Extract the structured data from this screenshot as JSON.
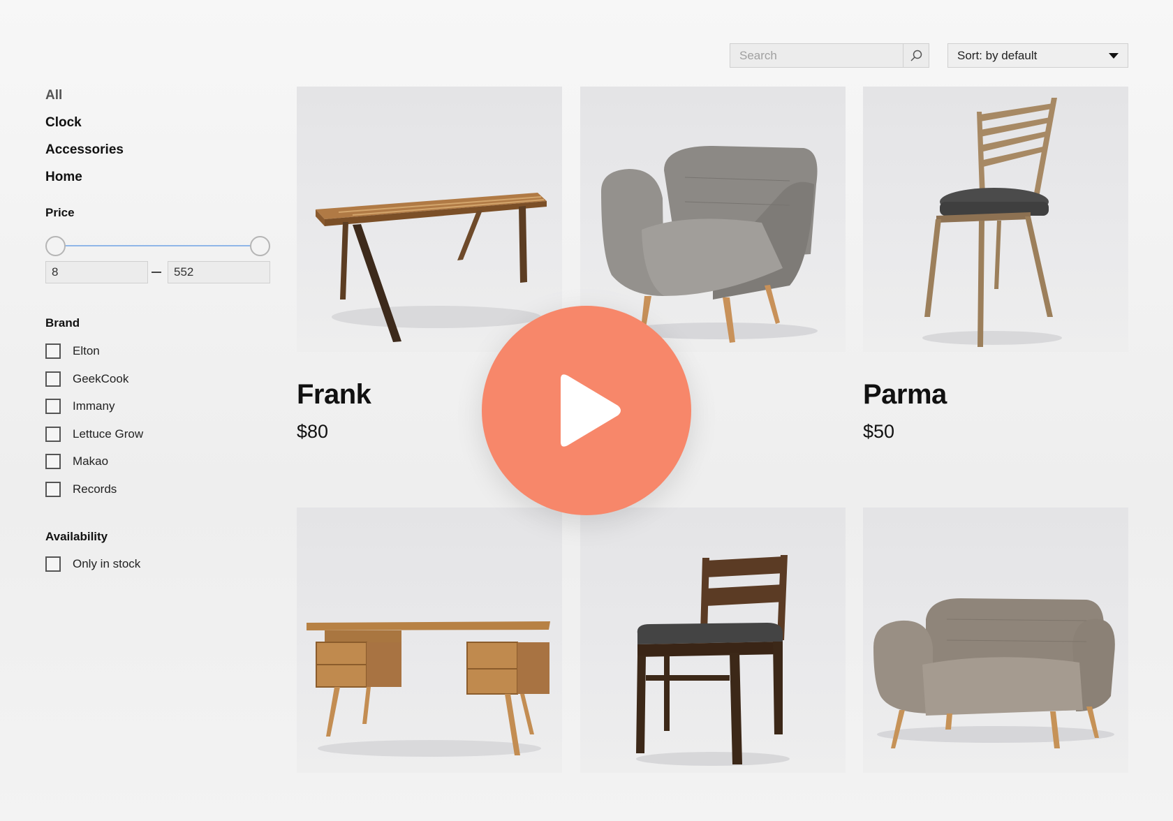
{
  "search": {
    "placeholder": "Search"
  },
  "sort": {
    "label": "Sort: by default"
  },
  "categories": [
    "All",
    "Clock",
    "Accessories",
    "Home"
  ],
  "filters": {
    "price": {
      "title": "Price",
      "min": "8",
      "max": "552"
    },
    "brand": {
      "title": "Brand",
      "items": [
        "Elton",
        "GeekCook",
        "Immany",
        "Lettuce Grow",
        "Makao",
        "Records"
      ]
    },
    "availability": {
      "title": "Availability",
      "items": [
        "Only in stock"
      ]
    }
  },
  "products": [
    {
      "name": "Frank",
      "price": "$80",
      "image": "wooden-table"
    },
    {
      "name": "",
      "price": "",
      "image": "gray-armchair"
    },
    {
      "name": "Parma",
      "price": "$50",
      "image": "wooden-chair"
    },
    {
      "image": "wooden-desk"
    },
    {
      "image": "dark-wooden-chair"
    },
    {
      "image": "gray-loveseat"
    }
  ],
  "colors": {
    "accent": "#f7876a",
    "slider": "#8fb6e8"
  }
}
